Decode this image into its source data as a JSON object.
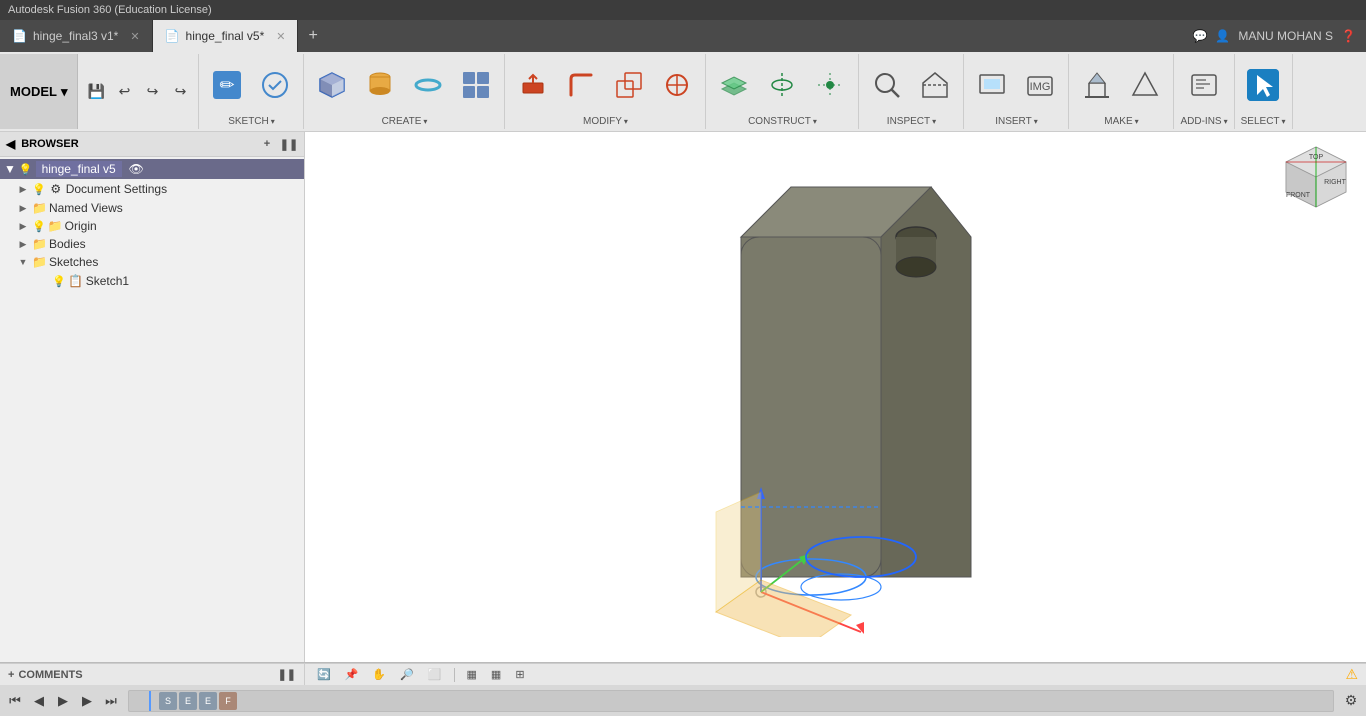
{
  "topbar": {
    "title": "Autodesk Fusion 360 (Education License)"
  },
  "tabs": [
    {
      "id": "tab1",
      "label": "hinge_final3 v1*",
      "icon": "📄",
      "active": false
    },
    {
      "id": "tab2",
      "label": "hinge_final v5*",
      "icon": "📄",
      "active": true
    }
  ],
  "tabbar": {
    "new_tab_label": "+",
    "user_label": "MANU MOHAN S",
    "help_label": "?"
  },
  "toolbar": {
    "model_label": "MODEL",
    "sketch_label": "SKETCH",
    "create_label": "CREATE",
    "modify_label": "MODIFY",
    "construct_label": "CONSTRUCT",
    "inspect_label": "INSPECT",
    "insert_label": "INSERT",
    "make_label": "MAKE",
    "addins_label": "ADD-INS",
    "select_label": "SELECT",
    "arrow": "▾"
  },
  "browser": {
    "title": "BROWSER",
    "root_item": "hinge_final v5",
    "items": [
      {
        "id": "doc-settings",
        "label": "Document Settings",
        "indent": 1,
        "expandable": true,
        "has_bulb": true,
        "icon": "⚙"
      },
      {
        "id": "named-views",
        "label": "Named Views",
        "indent": 1,
        "expandable": true,
        "has_bulb": false,
        "icon": "📁"
      },
      {
        "id": "origin",
        "label": "Origin",
        "indent": 1,
        "expandable": true,
        "has_bulb": true,
        "icon": "📁"
      },
      {
        "id": "bodies",
        "label": "Bodies",
        "indent": 1,
        "expandable": true,
        "has_bulb": false,
        "icon": "📁"
      },
      {
        "id": "sketches",
        "label": "Sketches",
        "indent": 1,
        "expandable": true,
        "has_bulb": false,
        "icon": "📁"
      },
      {
        "id": "sketch1",
        "label": "Sketch1",
        "indent": 2,
        "expandable": false,
        "has_bulb": true,
        "icon": "📋"
      }
    ]
  },
  "bottombar": {
    "nav_icons": [
      "🔍",
      "📋",
      "✋",
      "🔎",
      "⬜"
    ],
    "grid_icons": [
      "▦",
      "▦"
    ],
    "warning_icon": "⚠"
  },
  "comments": {
    "label": "COMMENTS",
    "plus_label": "+"
  },
  "timeline": {
    "play_first": "⏮",
    "play_prev": "◀",
    "play": "▶",
    "play_next": "▶",
    "play_last": "⏭",
    "settings_icon": "⚙"
  },
  "viewcube": {
    "top": "TOP",
    "right": "RIGHT",
    "front": "FRONT"
  },
  "colors": {
    "accent_blue": "#1a7fc1",
    "toolbar_bg": "#e8e8e8",
    "viewport_bg": "#ffffff",
    "tab_active_bg": "#e8e8e8",
    "tab_inactive_bg": "#4a4a4a",
    "browser_bg": "#f0f0f0"
  }
}
